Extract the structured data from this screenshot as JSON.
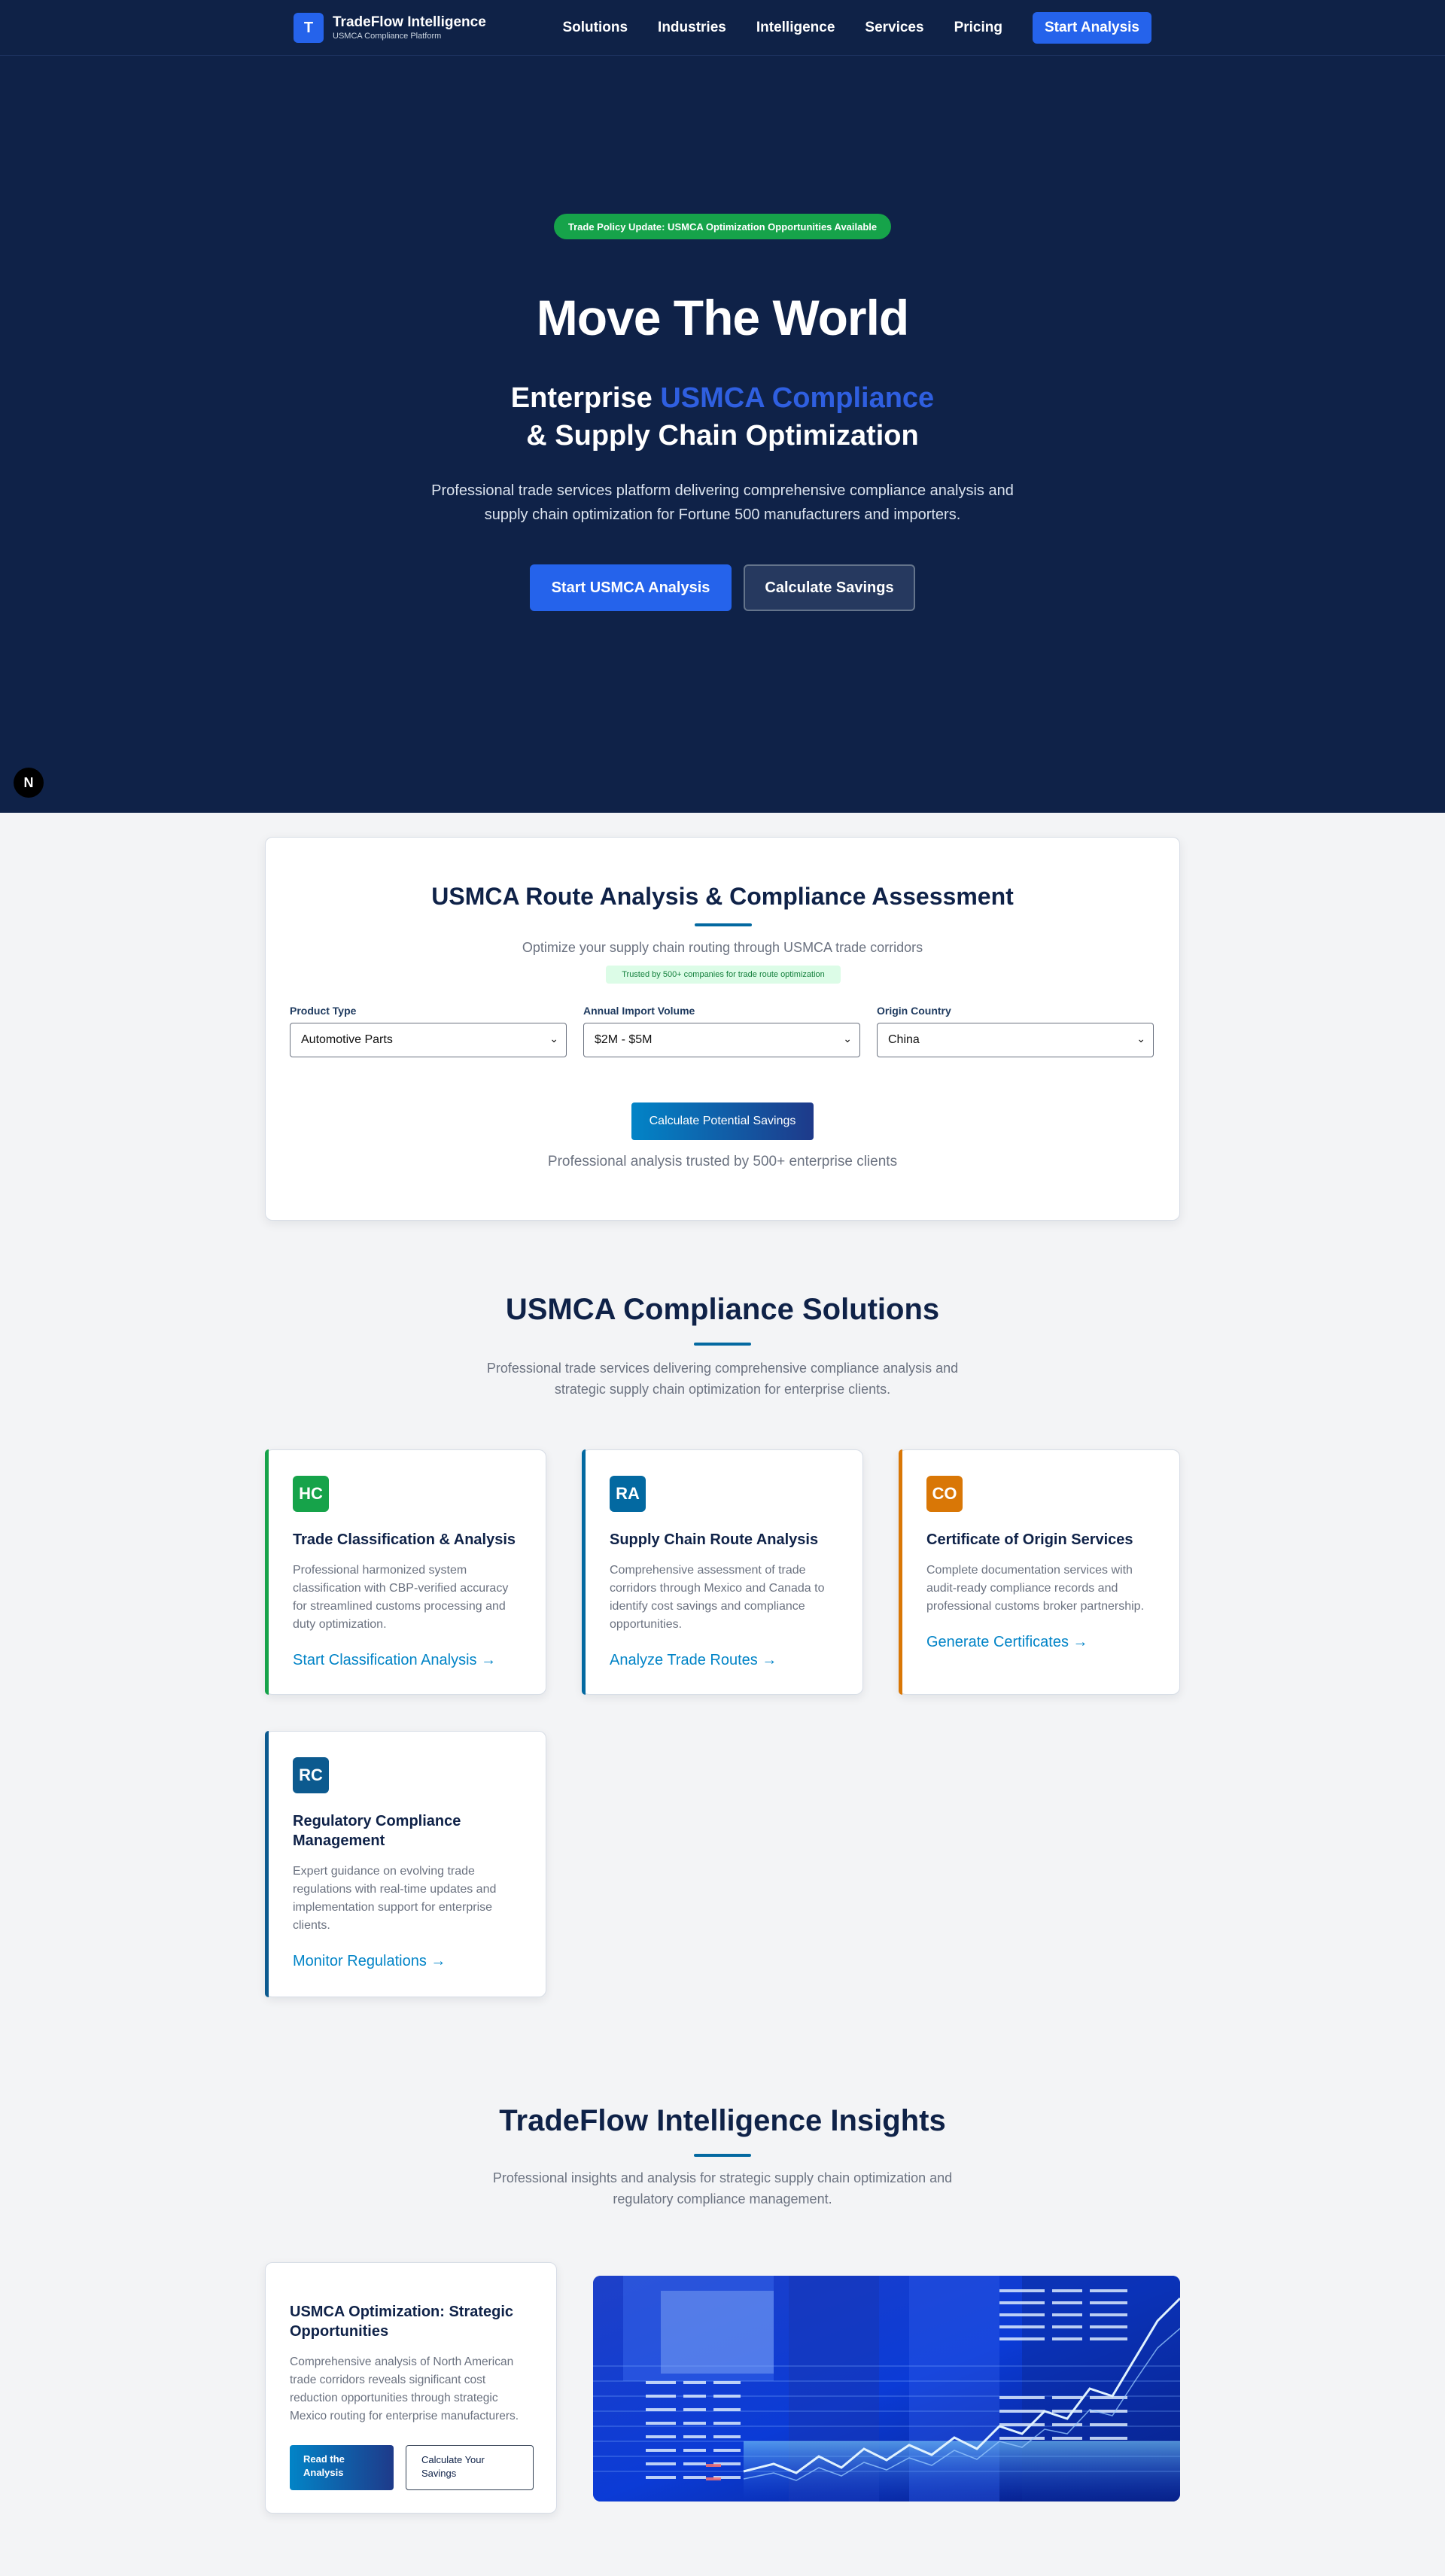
{
  "nav": {
    "logo_letter": "T",
    "brand": "TradeFlow Intelligence",
    "brand_sub": "USMCA Compliance Platform",
    "links": [
      "Solutions",
      "Industries",
      "Intelligence",
      "Services",
      "Pricing"
    ],
    "cta": "Start Analysis"
  },
  "hero": {
    "badge": "Trade Policy Update: USMCA Optimization Opportunities Available",
    "title": "Move The World",
    "sub_prefix": "Enterprise ",
    "sub_accent": "USMCA Compliance",
    "sub_line2": "& Supply Chain Optimization",
    "desc": "Professional trade services platform delivering comprehensive compliance analysis and supply chain optimization for Fortune 500 manufacturers and importers.",
    "btn_primary": "Start USMCA Analysis",
    "btn_secondary": "Calculate Savings",
    "corner_badge": "N"
  },
  "route": {
    "title": "USMCA Route Analysis & Compliance Assessment",
    "desc": "Optimize your supply chain routing through USMCA trade corridors",
    "trust": "Trusted by 500+ companies for trade route optimization",
    "fields": [
      {
        "label": "Product Type",
        "value": "Automotive Parts"
      },
      {
        "label": "Annual Import Volume",
        "value": "$2M - $5M"
      },
      {
        "label": "Origin Country",
        "value": "China"
      }
    ],
    "button": "Calculate Potential Savings",
    "footer": "Professional analysis trusted by 500+ enterprise clients"
  },
  "solutions": {
    "title": "USMCA Compliance Solutions",
    "desc": "Professional trade services delivering comprehensive compliance analysis and strategic supply chain optimization for enterprise clients.",
    "cards": [
      {
        "icon": "HC",
        "title": "Trade Classification & Analysis",
        "desc": "Professional harmonized system classification with CBP-verified accuracy for streamlined customs processing and duty optimization.",
        "link": "Start Classification Analysis →",
        "color": "#16a34a"
      },
      {
        "icon": "RA",
        "title": "Supply Chain Route Analysis",
        "desc": "Comprehensive assessment of trade corridors through Mexico and Canada to identify cost savings and compliance opportunities.",
        "link": "Analyze Trade Routes →",
        "color": "#0369a1"
      },
      {
        "icon": "CO",
        "title": "Certificate of Origin Services",
        "desc": "Complete documentation services with audit-ready compliance records and professional customs broker partnership.",
        "link": "Generate Certificates →",
        "color": "#d97706"
      },
      {
        "icon": "RC",
        "title": "Regulatory Compliance Management",
        "desc": "Expert guidance on evolving trade regulations with real-time updates and implementation support for enterprise clients.",
        "link": "Monitor Regulations →",
        "color": "#0c5a8f"
      }
    ]
  },
  "insights": {
    "title": "TradeFlow Intelligence Insights",
    "desc": "Professional insights and analysis for strategic supply chain optimization and regulatory compliance management.",
    "card_title": "USMCA Optimization: Strategic Opportunities",
    "card_desc": "Comprehensive analysis of North American trade corridors reveals significant cost reduction opportunities through strategic Mexico routing for enterprise manufacturers.",
    "btn_primary": "Read the Analysis",
    "btn_secondary": "Calculate Your Savings"
  }
}
